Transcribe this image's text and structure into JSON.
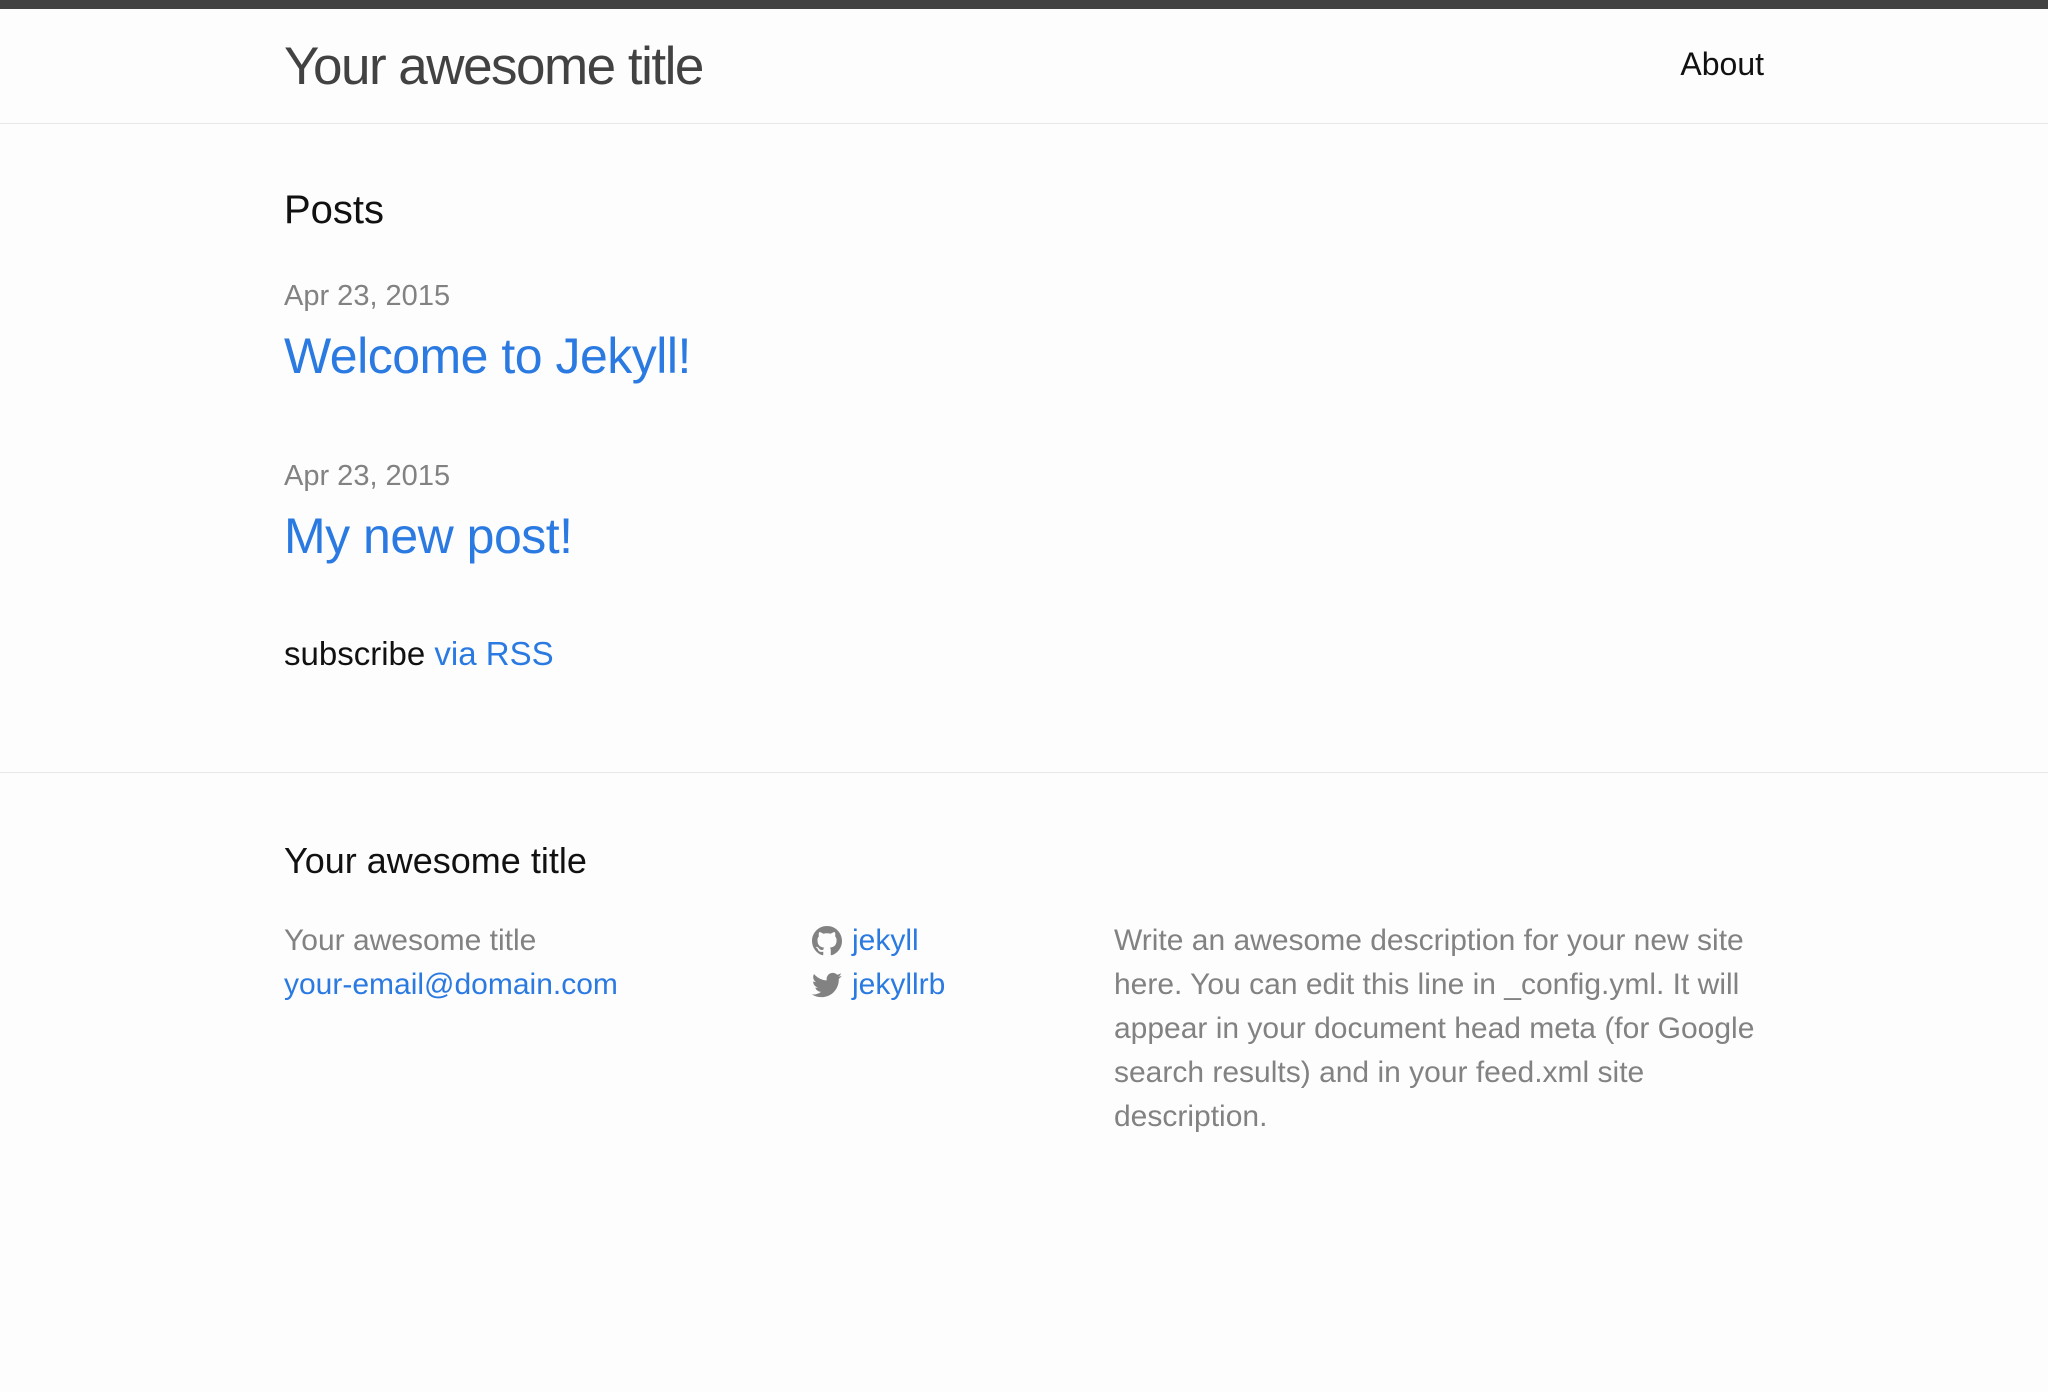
{
  "header": {
    "site_title": "Your awesome title",
    "nav": [
      {
        "label": "About"
      }
    ]
  },
  "main": {
    "heading": "Posts",
    "posts": [
      {
        "date": "Apr 23, 2015",
        "title": "Welcome to Jekyll!"
      },
      {
        "date": "Apr 23, 2015",
        "title": "My new post!"
      }
    ],
    "subscribe": {
      "prefix": "subscribe",
      "link_label": "via RSS"
    }
  },
  "footer": {
    "heading": "Your awesome title",
    "contact": {
      "name": "Your awesome title",
      "email": "your-email@domain.com"
    },
    "social": [
      {
        "icon": "github-icon",
        "label": "jekyll"
      },
      {
        "icon": "twitter-icon",
        "label": "jekyllrb"
      }
    ],
    "description": "Write an awesome description for your new site here. You can edit this line in _config.yml. It will appear in your document head meta (for Google search results) and in your feed.xml site description."
  },
  "colors": {
    "top_bar": "#424242",
    "link": "#2a7ae2",
    "muted_text": "#828282",
    "background": "#fdfdfd",
    "border": "#e8e8e8"
  }
}
